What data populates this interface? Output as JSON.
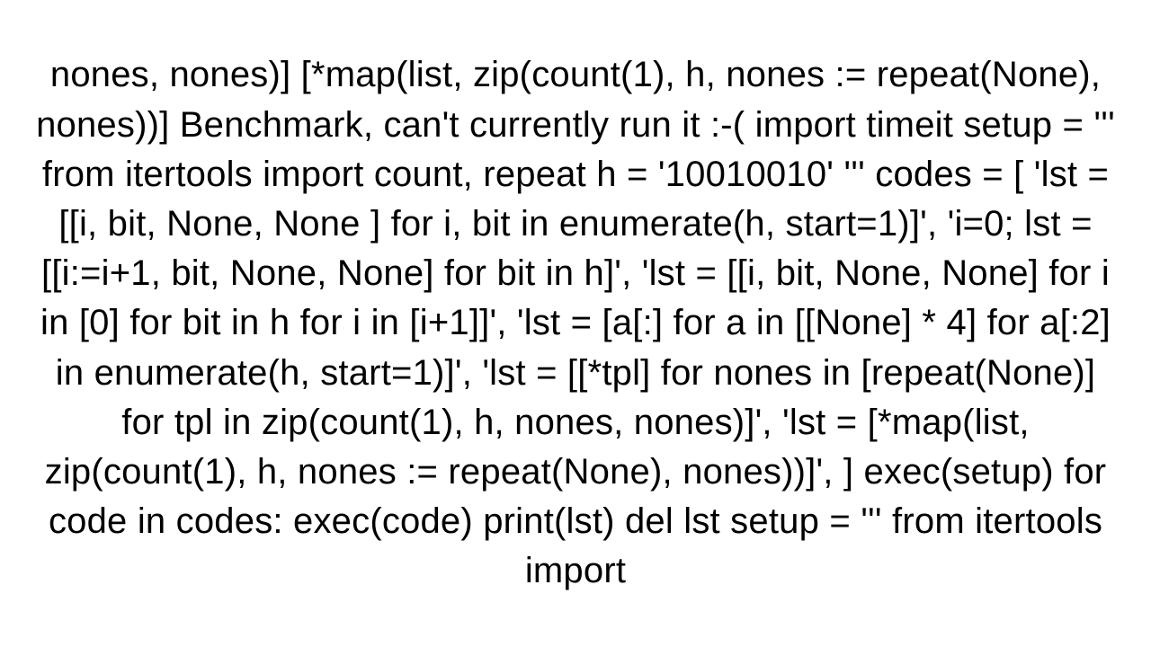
{
  "content": {
    "text": "nones, nones)]  [*map(list, zip(count(1), h, nones := repeat(None), nones))]  Benchmark, can't currently run it :-( import timeit  setup = ''' from itertools import count, repeat h = '10010010' '''  codes = [     'lst = [[i, bit, None, None ] for i, bit in enumerate(h, start=1)]',     'i=0; lst = [[i:=i+1, bit, None, None] for bit in h]',     'lst = [[i, bit, None, None] for i in [0] for bit in h for i in [i+1]]',     'lst = [a[:] for a in [[None] * 4] for a[:2] in enumerate(h, start=1)]',     'lst = [[*tpl] for nones in [repeat(None)] for tpl in zip(count(1), h, nones, nones)]',     'lst = [*map(list, zip(count(1), h, nones := repeat(None), nones))]', ]  exec(setup) for code in codes:     exec(code)     print(lst)     del lst  setup = ''' from itertools import"
  }
}
